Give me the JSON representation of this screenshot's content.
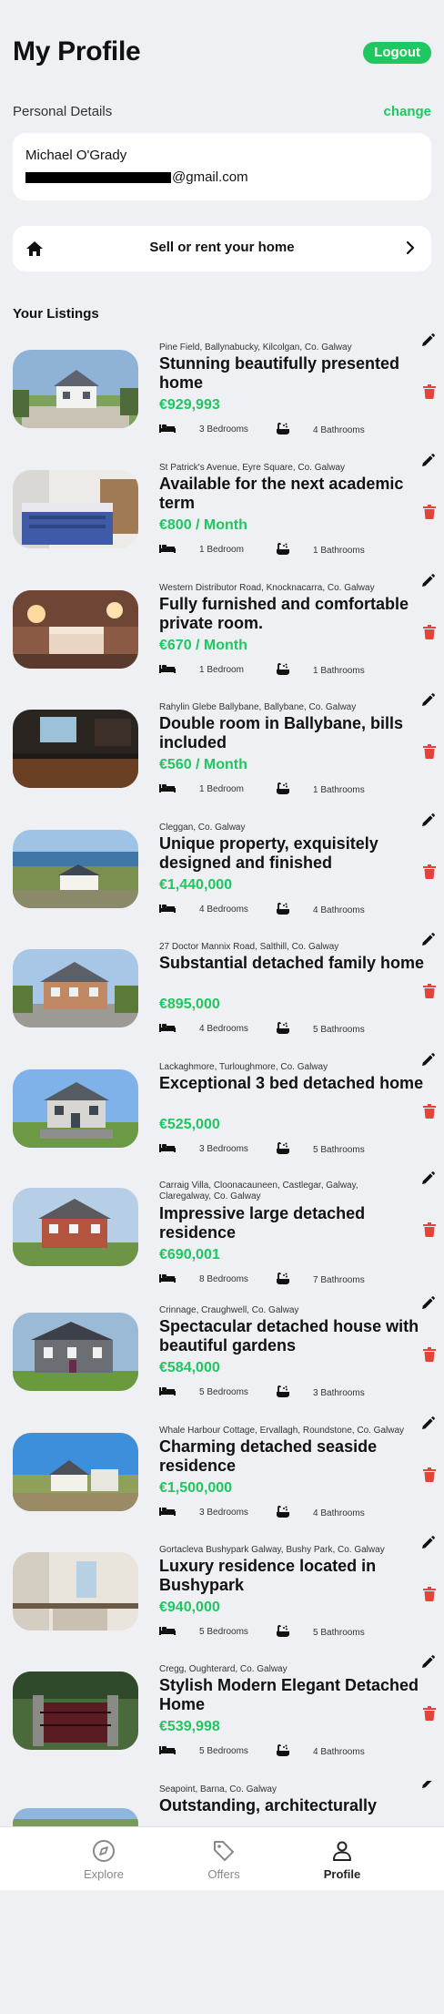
{
  "header": {
    "title": "My Profile",
    "logout_label": "Logout"
  },
  "personal": {
    "label": "Personal Details",
    "change_label": "change",
    "name": "Michael O'Grady",
    "email_suffix": "@gmail.com"
  },
  "sell": {
    "label": "Sell or rent your home"
  },
  "listings_title": "Your Listings",
  "listings": [
    {
      "address": "Pine Field, Ballynabucky, Kilcolgan, Co. Galway",
      "title": "Stunning beautifully presented home",
      "price": "€929,993",
      "beds": "3 Bedrooms",
      "baths": "4 Bathrooms"
    },
    {
      "address": "St Patrick's Avenue, Eyre Square, Co. Galway",
      "title": "Available for the next academic term",
      "price": "€800 / Month",
      "beds": "1 Bedroom",
      "baths": "1 Bathrooms"
    },
    {
      "address": "Western Distributor Road, Knocknacarra, Co. Galway",
      "title": "Fully furnished and comfortable private room.",
      "price": "€670 / Month",
      "beds": "1 Bedroom",
      "baths": "1 Bathrooms"
    },
    {
      "address": "Rahylin Glebe Ballybane, Ballybane, Co. Galway",
      "title": "Double room in Ballybane, bills included",
      "price": "€560 / Month",
      "beds": "1 Bedroom",
      "baths": "1 Bathrooms"
    },
    {
      "address": "Cleggan, Co. Galway",
      "title": "Unique property, exquisitely designed and finished",
      "price": "€1,440,000",
      "beds": "4 Bedrooms",
      "baths": "4 Bathrooms"
    },
    {
      "address": "27 Doctor Mannix Road, Salthill, Co. Galway",
      "title": "Substantial detached family home",
      "price": "€895,000",
      "beds": "4 Bedrooms",
      "baths": "5 Bathrooms"
    },
    {
      "address": "Lackaghmore, Turloughmore, Co. Galway",
      "title": "Exceptional 3 bed detached home",
      "price": "€525,000",
      "beds": "3 Bedrooms",
      "baths": "5 Bathrooms"
    },
    {
      "address": "Carraig Villa, Cloonacauneen, Castlegar, Galway, Claregalway, Co. Galway",
      "title": "Impressive large detached residence",
      "price": "€690,001",
      "beds": "8 Bedrooms",
      "baths": "7 Bathrooms"
    },
    {
      "address": "Crinnage, Craughwell, Co. Galway",
      "title": "Spectacular detached house with beautiful gardens",
      "price": "€584,000",
      "beds": "5 Bedrooms",
      "baths": "3 Bathrooms"
    },
    {
      "address": "Whale Harbour Cottage, Ervallagh, Roundstone, Co. Galway",
      "title": "Charming detached seaside residence",
      "price": "€1,500,000",
      "beds": "3 Bedrooms",
      "baths": "4 Bathrooms"
    },
    {
      "address": "Gortacleva Bushypark Galway, Bushy Park, Co. Galway",
      "title": "Luxury residence located in Bushypark",
      "price": "€940,000",
      "beds": "5 Bedrooms",
      "baths": "5 Bathrooms"
    },
    {
      "address": "Cregg, Oughterard, Co. Galway",
      "title": "Stylish Modern Elegant Detached Home",
      "price": "€539,998",
      "beds": "5 Bedrooms",
      "baths": "4 Bathrooms"
    },
    {
      "address": "Seapoint, Barna, Co. Galway",
      "title": "Outstanding, architecturally",
      "price": "",
      "beds": "",
      "baths": ""
    }
  ],
  "tabs": [
    {
      "label": "Explore",
      "icon": "compass-icon"
    },
    {
      "label": "Offers",
      "icon": "tag-icon"
    },
    {
      "label": "Profile",
      "icon": "person-icon"
    }
  ],
  "colors": {
    "accent": "#1ec760",
    "delete": "#e2443a",
    "background": "#eff0f4"
  }
}
